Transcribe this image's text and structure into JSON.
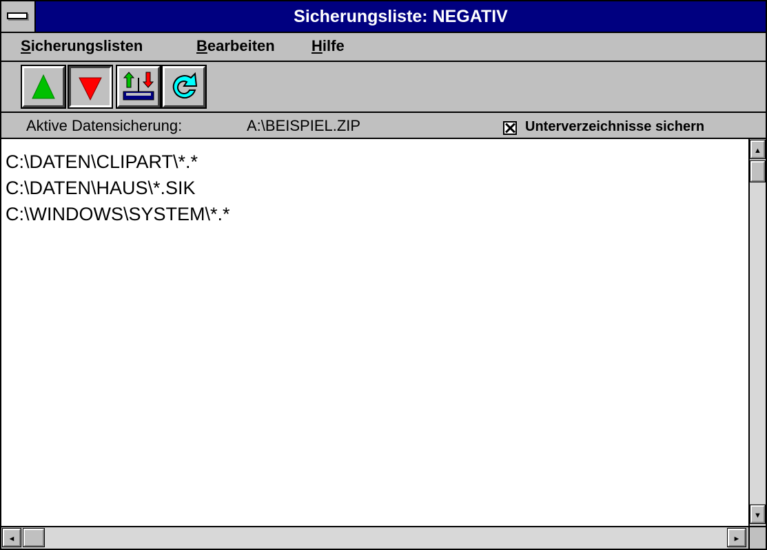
{
  "window": {
    "title": "Sicherungsliste: NEGATIV"
  },
  "menu": {
    "items": [
      {
        "label": "Sicherungslisten",
        "accel": "S"
      },
      {
        "label": "Bearbeiten",
        "accel": "B"
      },
      {
        "label": "Hilfe",
        "accel": "H"
      }
    ]
  },
  "toolbar": {
    "buttons": [
      {
        "icon": "arrow-up-green-icon",
        "color": "#00c000"
      },
      {
        "icon": "arrow-down-red-icon",
        "color": "#ff0000",
        "pressed": true
      },
      {
        "icon": "swap-transfer-icon",
        "color": "#000080"
      },
      {
        "icon": "refresh-arrow-icon",
        "color": "#00ffff"
      }
    ]
  },
  "info": {
    "label": "Aktive Datensicherung:",
    "value": "A:\\BEISPIEL.ZIP",
    "checkbox_label": "Unterverzeichnisse sichern",
    "checkbox_checked": true
  },
  "list": {
    "items": [
      "C:\\DATEN\\CLIPART\\*.*",
      "C:\\DATEN\\HAUS\\*.SIK",
      "C:\\WINDOWS\\SYSTEM\\*.*"
    ]
  },
  "scrollbars": {
    "up_glyph": "▲",
    "down_glyph": "▼",
    "left_glyph": "◄",
    "right_glyph": "►"
  }
}
